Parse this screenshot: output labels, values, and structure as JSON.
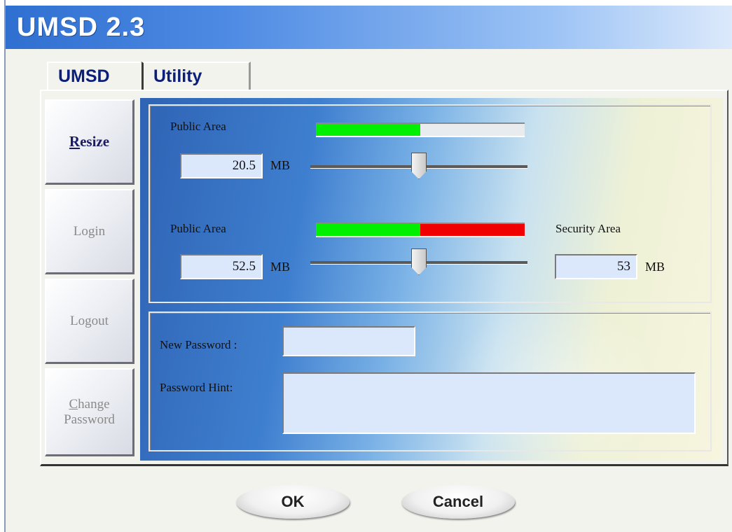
{
  "window": {
    "title": "UMSD 2.3"
  },
  "tabs": [
    {
      "label": "UMSD",
      "active": true
    },
    {
      "label": "Utility",
      "active": false
    }
  ],
  "sidebar": {
    "resize": {
      "pre": "",
      "accel": "R",
      "post": "esize"
    },
    "login": {
      "pre": "Lo",
      "accel": "g",
      "post": "in"
    },
    "logout": {
      "pre": "Lo",
      "accel": "g",
      "post": "out"
    },
    "change_password": {
      "line1_accel": "C",
      "line1_post": "hange",
      "line2": "Password"
    }
  },
  "resize": {
    "single": {
      "label": "Public Area",
      "value": "20.5",
      "unit": "MB",
      "bar_public_fraction": 0.5,
      "slider_fraction": 0.5
    },
    "split": {
      "public_label": "Public Area",
      "public_value": "52.5",
      "public_unit": "MB",
      "security_label": "Security Area",
      "security_value": "53",
      "security_unit": "MB",
      "bar_public_fraction": 0.5,
      "slider_fraction": 0.5
    }
  },
  "password": {
    "new_password_label": "New Password :",
    "new_password_value": "",
    "hint_label": "Password Hint:",
    "hint_value": ""
  },
  "buttons": {
    "ok": "OK",
    "cancel": "Cancel"
  },
  "colors": {
    "public_bar": "#00f000",
    "security_bar": "#f00000"
  },
  "icons": {
    "slider_thumb": "slider-thumb-icon"
  }
}
